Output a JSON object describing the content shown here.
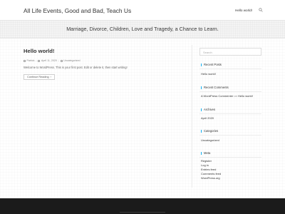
{
  "header": {
    "site_title": "All Life Events, Good and Bad, Teach Us",
    "nav_link": "Hello world!",
    "search_icon": "search-icon"
  },
  "banner": {
    "tagline": "Marriage, Divorce, Children, Love and Tragedy, a Chance to Learn."
  },
  "post": {
    "title": "Hello world!",
    "author": "Patrick",
    "date": "April 11, 2020",
    "category": "Uncategorized",
    "excerpt": "Welcome to WordPress. This is your first post. Edit or delete it, then start writing!",
    "continue_label": "Continue Reading",
    "continue_arrow": "›"
  },
  "sidebar": {
    "search_placeholder": "Search",
    "recent_posts": {
      "title": "Recent Posts",
      "items": [
        "Hello world!"
      ]
    },
    "recent_comments": {
      "title": "Recent Comments",
      "commenter": "A WordPress Commenter",
      "on_word": "on",
      "post": "Hello world!"
    },
    "archives": {
      "title": "Archives",
      "items": [
        "April 2020"
      ]
    },
    "categories": {
      "title": "Categories",
      "items": [
        "Uncategorized"
      ]
    },
    "meta": {
      "title": "Meta",
      "items": [
        "Register",
        "Log in",
        "Entries feed",
        "Comments feed",
        "WordPress.org"
      ]
    }
  },
  "colors": {
    "accent": "#13aff0",
    "footer_bg": "#1b1b1b",
    "banner_bg": "#f4f4f4"
  }
}
